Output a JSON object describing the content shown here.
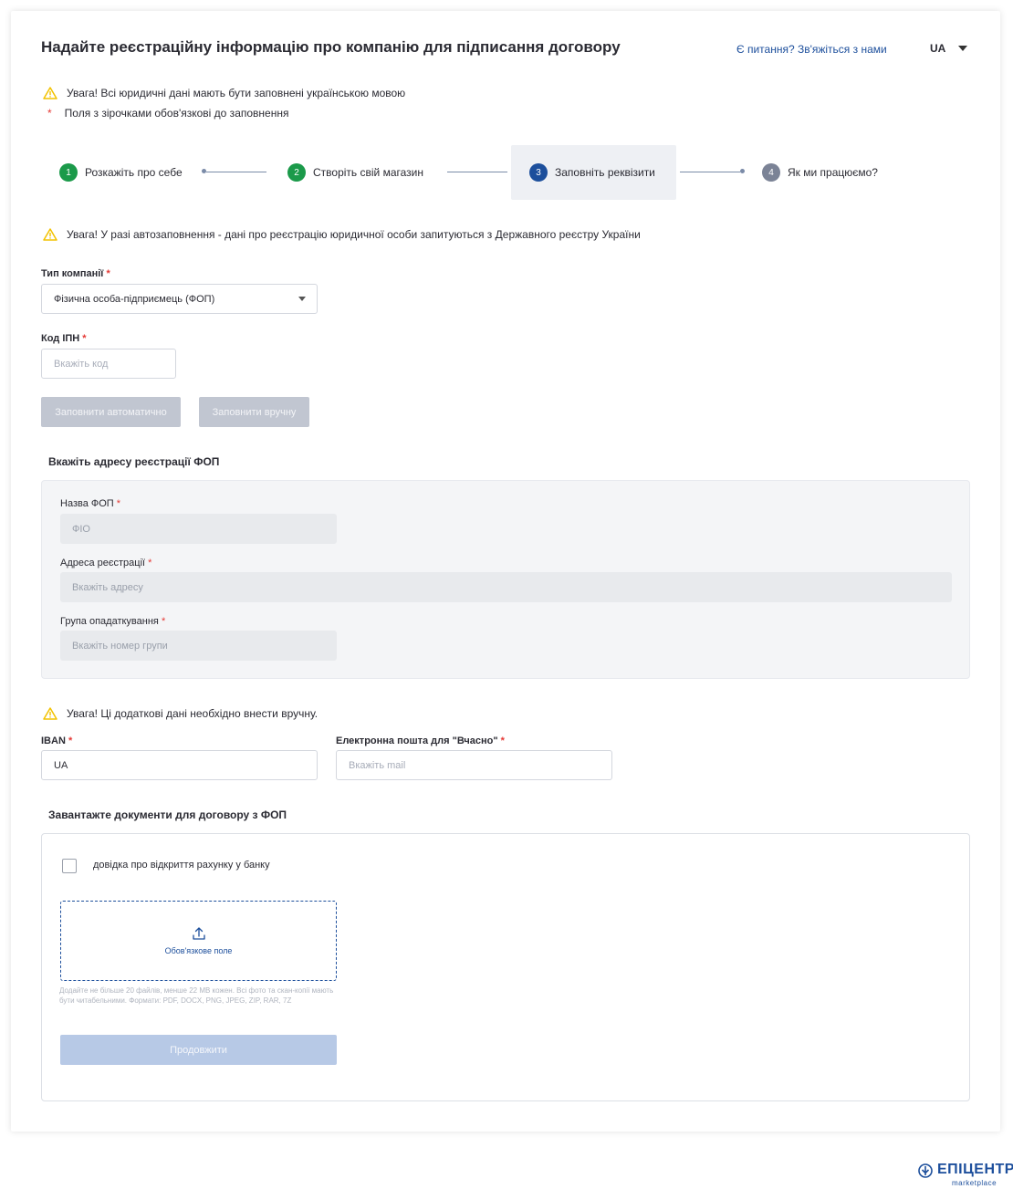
{
  "header": {
    "title": "Надайте реєстраційну інформацію про компанію для підписання договору",
    "help_link": "Є питання? Зв'яжіться з нами",
    "language": "UA"
  },
  "notices": {
    "warning_language": "Увага! Всі юридичні дані мають бути заповнені українською мовою",
    "required_fields": "Поля з зірочками обов'язкові до заповнення",
    "asterisk": "*"
  },
  "stepper": {
    "steps": [
      {
        "number": "1",
        "label": "Розкажіть про себе",
        "color": "#1b9a4a"
      },
      {
        "number": "2",
        "label": "Створіть свій магазин",
        "color": "#1b9a4a"
      },
      {
        "number": "3",
        "label": "Заповніть реквізити",
        "color": "#1d4f9c"
      },
      {
        "number": "4",
        "label": "Як ми працюємо?",
        "color": "#7b8396"
      }
    ],
    "active_step": 3
  },
  "autofill_warning": "Увага! У разі автозаповнення - дані про реєстрацію юридичної особи запитуються з Державного реєстру України",
  "company_type": {
    "label": "Тип компанії",
    "value": "Фізична особа-підприємець (ФОП)"
  },
  "ipn": {
    "label": "Код ІПН",
    "placeholder": "Вкажіть код"
  },
  "buttons": {
    "autofill": "Заповнити автоматично",
    "manual": "Заповнити вручну",
    "continue": "Продовжити"
  },
  "address_section": {
    "title": "Вкажіть адресу реєстрації ФОП",
    "name_label": "Назва ФОП",
    "name_placeholder": "ФІО",
    "address_label": "Адреса реєстрації",
    "address_placeholder": "Вкажіть адресу",
    "tax_label": "Група опадаткування",
    "tax_placeholder": "Вкажіть номер групи"
  },
  "extra_warning": "Увага! Ці додаткові дані необхідно внести вручну.",
  "iban": {
    "label": "IBAN",
    "value": "UA"
  },
  "email": {
    "label": "Електронна пошта для \"Вчасно\"",
    "placeholder": "Вкажіть mail"
  },
  "documents": {
    "title": "Завантажте документи для договору з ФОП",
    "checkbox_label": "довідка про відкриття рахунку у банку",
    "dropzone_label": "Обов'язкове поле",
    "hint": "Додайте не більше 20 файлів, менше 22 МВ кожен. Всі фото та скан-копії мають бути читабельними. Формати: PDF, DOCX, PNG, JPEG, ZIP, RAR, 7Z"
  },
  "logo": {
    "name": "ЕПІЦЕНТР",
    "sub": "marketplace"
  },
  "colors": {
    "accent": "#1d4f9c",
    "success": "#1b9a4a",
    "warning": "#f2c200",
    "required": "#e53935"
  }
}
